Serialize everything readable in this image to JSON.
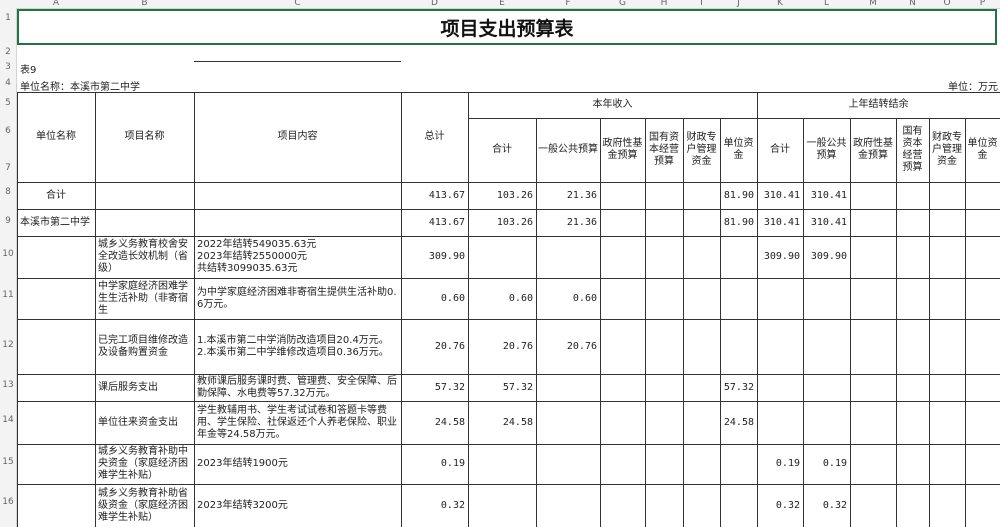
{
  "sheet": {
    "title": "项目支出预算表",
    "table_no": "表9",
    "unit_name_label": "单位名称：本溪市第二中学",
    "unit_label": "单位：万元"
  },
  "column_letters": [
    "A",
    "B",
    "C",
    "D",
    "E",
    "F",
    "G",
    "H",
    "I",
    "J",
    "K",
    "L",
    "M",
    "N",
    "O",
    "P"
  ],
  "row_numbers": [
    "1",
    "2",
    "3",
    "4",
    "5",
    "6",
    "7",
    "8",
    "9",
    "10",
    "11",
    "12",
    "13",
    "14",
    "15",
    "16"
  ],
  "headers": {
    "unit_name": "单位名称",
    "project_name": "项目名称",
    "project_content": "项目内容",
    "total": "总计",
    "current_income": "本年收入",
    "prev_balance": "上年结转结余",
    "sub": {
      "subtotal": "合计",
      "general_budget": "一般公共预算",
      "gov_fund": "政府性基金预算",
      "state_capital": "国有资本经营预算",
      "fiscal_special": "财政专户管理资金",
      "unit_funds": "单位资金"
    }
  },
  "rows": [
    {
      "unit": "合计",
      "project": "",
      "content": "",
      "total": "413.67",
      "e": "103.26",
      "f": "21.36",
      "g": "",
      "h": "",
      "i": "",
      "j": "81.90",
      "k": "310.41",
      "l": "310.41",
      "m": "",
      "n": "",
      "o": "",
      "p": ""
    },
    {
      "unit": "本溪市第二中学",
      "project": "",
      "content": "",
      "total": "413.67",
      "e": "103.26",
      "f": "21.36",
      "g": "",
      "h": "",
      "i": "",
      "j": "81.90",
      "k": "310.41",
      "l": "310.41",
      "m": "",
      "n": "",
      "o": "",
      "p": ""
    },
    {
      "unit": "",
      "project": "城乡义务教育校舍安全改造长效机制（省级）",
      "content": "2022年结转549035.63元\n2023年结转2550000元\n共结转3099035.63元",
      "total": "309.90",
      "e": "",
      "f": "",
      "g": "",
      "h": "",
      "i": "",
      "j": "",
      "k": "309.90",
      "l": "309.90",
      "m": "",
      "n": "",
      "o": "",
      "p": ""
    },
    {
      "unit": "",
      "project": "中学家庭经济困难学生生活补助（非寄宿生",
      "content": "为中学家庭经济困难非寄宿生提供生活补助0.6万元。",
      "total": "0.60",
      "e": "0.60",
      "f": "0.60",
      "g": "",
      "h": "",
      "i": "",
      "j": "",
      "k": "",
      "l": "",
      "m": "",
      "n": "",
      "o": "",
      "p": ""
    },
    {
      "unit": "",
      "project": "已完工项目维修改造及设备购置资金",
      "content": "1.本溪市第二中学消防改造项目20.4万元。\n2.本溪市第二中学维修改造项目0.36万元。",
      "total": "20.76",
      "e": "20.76",
      "f": "20.76",
      "g": "",
      "h": "",
      "i": "",
      "j": "",
      "k": "",
      "l": "",
      "m": "",
      "n": "",
      "o": "",
      "p": ""
    },
    {
      "unit": "",
      "project": "课后服务支出",
      "content": "教师课后服务课时费、管理费、安全保障、后勤保障、水电费等57.32万元。",
      "total": "57.32",
      "e": "57.32",
      "f": "",
      "g": "",
      "h": "",
      "i": "",
      "j": "57.32",
      "k": "",
      "l": "",
      "m": "",
      "n": "",
      "o": "",
      "p": ""
    },
    {
      "unit": "",
      "project": "单位往来资金支出",
      "content": "学生教辅用书、学生考试试卷和答题卡等费用、学生保险、社保返还个人养老保险、职业年金等24.58万元。",
      "total": "24.58",
      "e": "24.58",
      "f": "",
      "g": "",
      "h": "",
      "i": "",
      "j": "24.58",
      "k": "",
      "l": "",
      "m": "",
      "n": "",
      "o": "",
      "p": ""
    },
    {
      "unit": "",
      "project": "城乡义务教育补助中央资金（家庭经济困难学生补贴）",
      "content": "2023年结转1900元",
      "total": "0.19",
      "e": "",
      "f": "",
      "g": "",
      "h": "",
      "i": "",
      "j": "",
      "k": "0.19",
      "l": "0.19",
      "m": "",
      "n": "",
      "o": "",
      "p": ""
    },
    {
      "unit": "",
      "project": "城乡义务教育补助省级资金（家庭经济困难学生补贴）",
      "content": "2023年结转3200元",
      "total": "0.32",
      "e": "",
      "f": "",
      "g": "",
      "h": "",
      "i": "",
      "j": "",
      "k": "0.32",
      "l": "0.32",
      "m": "",
      "n": "",
      "o": "",
      "p": ""
    }
  ]
}
